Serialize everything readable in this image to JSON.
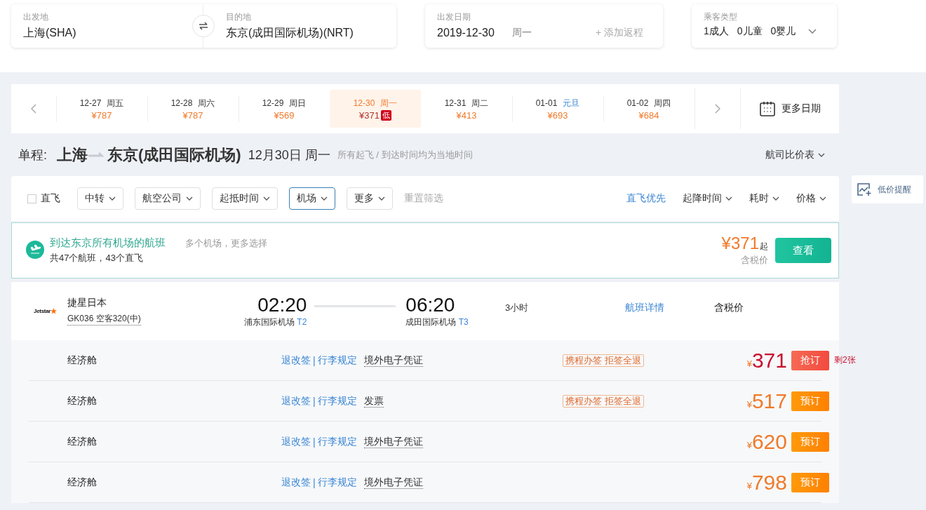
{
  "search": {
    "origin": {
      "label": "出发地",
      "value": "上海(SHA)"
    },
    "destination": {
      "label": "目的地",
      "value": "东京(成田国际机场)(NRT)"
    },
    "date": {
      "label": "出发日期",
      "value": "2019-12-30",
      "weekday": "周一",
      "return_placeholder": "+ 添加返程"
    },
    "passengers": {
      "label": "乘客类型",
      "values": [
        "1成人",
        "0儿童",
        "0婴儿"
      ]
    }
  },
  "date_strip": {
    "dates": [
      {
        "date": "12-27",
        "day": "周五",
        "price": "¥787",
        "holiday": false,
        "selected": false
      },
      {
        "date": "12-28",
        "day": "周六",
        "price": "¥787",
        "holiday": false,
        "selected": false
      },
      {
        "date": "12-29",
        "day": "周日",
        "price": "¥569",
        "holiday": false,
        "selected": false
      },
      {
        "date": "12-30",
        "day": "周一",
        "price": "¥371",
        "holiday": false,
        "selected": true,
        "badge": "低"
      },
      {
        "date": "12-31",
        "day": "周二",
        "price": "¥413",
        "holiday": false,
        "selected": false
      },
      {
        "date": "01-01",
        "day": "元旦",
        "price": "¥693",
        "holiday": true,
        "selected": false
      },
      {
        "date": "01-02",
        "day": "周四",
        "price": "¥684",
        "holiday": false,
        "selected": false
      }
    ],
    "more": "更多日期"
  },
  "route": {
    "label": "单程:",
    "from": "上海",
    "to": "东京(成田国际机场)",
    "date": "12月30日 周一",
    "note": "所有起飞 / 到达时间均为当地时间",
    "compare": "航司比价表"
  },
  "filters": {
    "direct": {
      "label": "直飞",
      "checked": false
    },
    "dropdowns": [
      {
        "label": "中转",
        "selected": false
      },
      {
        "label": "航空公司",
        "selected": false
      },
      {
        "label": "起抵时间",
        "selected": false
      },
      {
        "label": "机场",
        "selected": true
      },
      {
        "label": "更多",
        "selected": false
      }
    ],
    "reset": "重置筛选",
    "sorts": [
      {
        "label": "直飞优先",
        "selected": true,
        "dropdown": false
      },
      {
        "label": "起降时间",
        "selected": false,
        "dropdown": true
      },
      {
        "label": "耗时",
        "selected": false,
        "dropdown": true
      },
      {
        "label": "价格",
        "selected": false,
        "dropdown": true
      }
    ]
  },
  "banner": {
    "title": "到达东京所有机场的航班",
    "subtitle": "多个机场，更多选择",
    "summary": "共47个航班，43个直飞",
    "price": "¥371",
    "price_suffix": "起",
    "tax_note": "含税价",
    "button": "查看"
  },
  "flight": {
    "logo": "Jetstar",
    "airline": "捷星日本",
    "flight_no": "GK036 空客320(中)",
    "depart": {
      "time": "02:20",
      "airport": "浦东国际机场",
      "terminal": "T2"
    },
    "arrive": {
      "time": "06:20",
      "airport": "成田国际机场",
      "terminal": "T3"
    },
    "duration": "3小时",
    "details": "航班详情",
    "price_label": "含税价"
  },
  "fares": [
    {
      "cabin": "经济舱",
      "links": [
        "退改签",
        "行李规定"
      ],
      "separator": "|",
      "voucher": "境外电子凭证",
      "tag": "携程办签 拒签全退",
      "currency": "¥",
      "price": "371",
      "button": {
        "label": "抢订",
        "kind": "grab"
      },
      "remaining": "剩2张"
    },
    {
      "cabin": "经济舱",
      "links": [
        "退改签",
        "行李规定"
      ],
      "separator": "|",
      "voucher": "发票",
      "tag": "携程办签 拒签全退",
      "currency": "¥",
      "price": "517",
      "button": {
        "label": "预订",
        "kind": "book"
      }
    },
    {
      "cabin": "经济舱",
      "links": [
        "退改签",
        "行李规定"
      ],
      "separator": "|",
      "voucher": "境外电子凭证",
      "currency": "¥",
      "price": "620",
      "button": {
        "label": "预订",
        "kind": "book"
      }
    },
    {
      "cabin": "经济舱",
      "links": [
        "退改签",
        "行李规定"
      ],
      "separator": "|",
      "voucher": "境外电子凭证",
      "currency": "¥",
      "price": "798",
      "button": {
        "label": "预订",
        "kind": "book"
      }
    }
  ],
  "alert": {
    "label": "低价提醒"
  }
}
